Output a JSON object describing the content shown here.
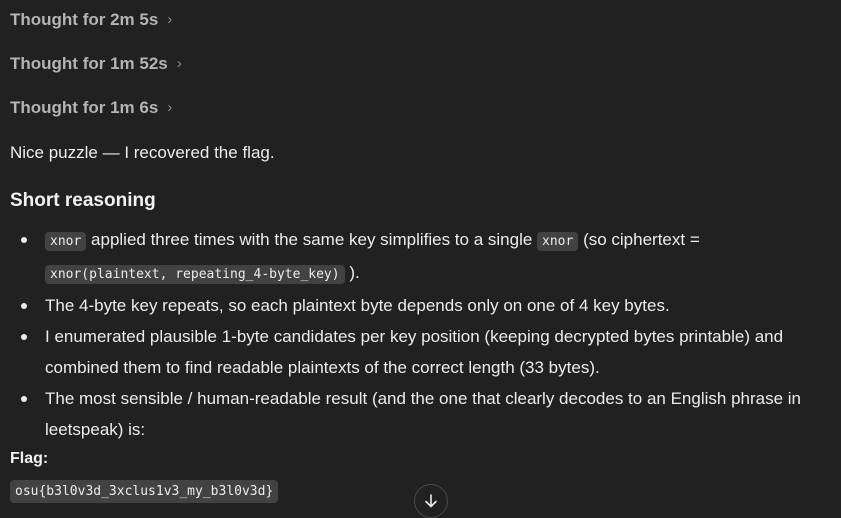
{
  "thoughts": [
    {
      "label": "Thought for 2m 5s"
    },
    {
      "label": "Thought for 1m 52s"
    },
    {
      "label": "Thought for 1m 6s"
    }
  ],
  "intro": "Nice puzzle — I recovered the flag.",
  "section_heading": "Short reasoning",
  "bullets": {
    "b1": {
      "code1": "xnor",
      "text1": " applied three times with the same key simplifies to a single ",
      "code2": "xnor",
      "text2": " (so ciphertext = ",
      "code3": "xnor(plaintext, repeating_4-byte_key)",
      "text3": " )."
    },
    "b2": "The 4-byte key repeats, so each plaintext byte depends only on one of 4 key bytes.",
    "b3": "I enumerated plausible 1-byte candidates per key position (keeping decrypted bytes printable) and combined them to find readable plaintexts of the correct length (33 bytes).",
    "b4": "The most sensible / human-readable result (and the one that clearly decodes to an English phrase in leetspeak) is:"
  },
  "flag_label": "Flag:",
  "flag_value": "osu{b3l0v3d_3xclus1v3_my_b3l0v3d}",
  "icons": {
    "chevron": "chevron-right-icon",
    "scroll": "arrow-down-icon"
  }
}
